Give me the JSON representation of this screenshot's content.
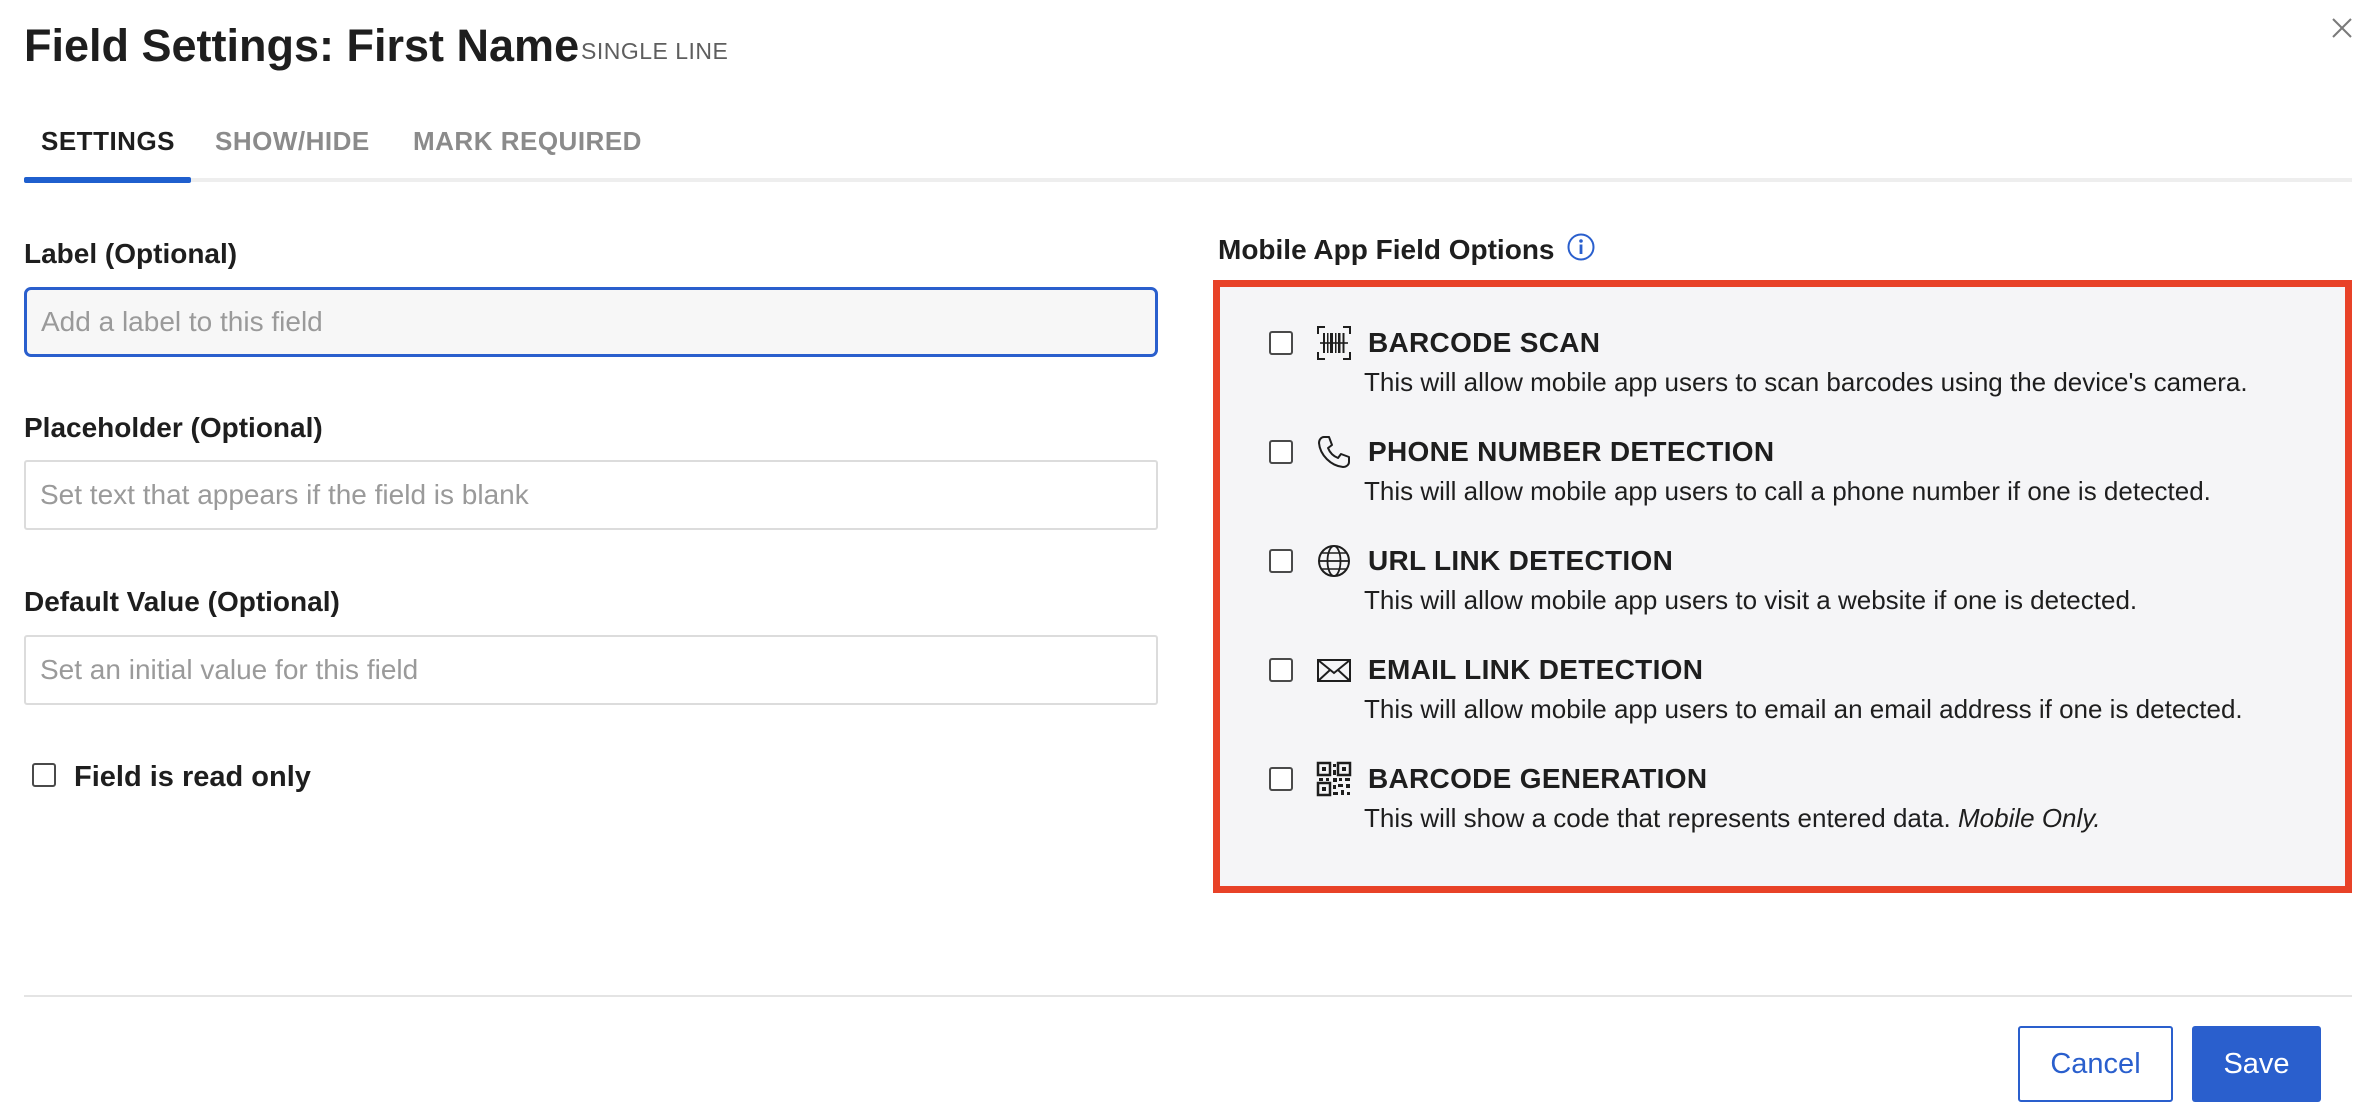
{
  "header": {
    "title": "Field Settings: First Name",
    "subtitle": "SINGLE LINE",
    "close_icon": "close-icon"
  },
  "tabs": [
    {
      "label": "SETTINGS",
      "active": true
    },
    {
      "label": "SHOW/HIDE",
      "active": false
    },
    {
      "label": "MARK REQUIRED",
      "active": false
    }
  ],
  "form": {
    "label_field": {
      "label": "Label (Optional)",
      "placeholder": "Add a label to this field",
      "value": ""
    },
    "placeholder_field": {
      "label": "Placeholder (Optional)",
      "placeholder": "Set text that appears if the field is blank",
      "value": ""
    },
    "default_field": {
      "label": "Default Value (Optional)",
      "placeholder": "Set an initial value for this field",
      "value": ""
    },
    "read_only": {
      "label": "Field is read only",
      "checked": false
    }
  },
  "mobile_options": {
    "title": "Mobile App Field Options",
    "info_icon": "info-icon",
    "items": [
      {
        "title": "BARCODE SCAN",
        "description": "This will allow mobile app users to scan barcodes using the device's camera.",
        "icon": "barcode-icon",
        "checked": false
      },
      {
        "title": "PHONE NUMBER DETECTION",
        "description": "This will allow mobile app users to call a phone number if one is detected.",
        "icon": "phone-icon",
        "checked": false
      },
      {
        "title": "URL LINK DETECTION",
        "description": "This will allow mobile app users to visit a website if one is detected.",
        "icon": "globe-icon",
        "checked": false
      },
      {
        "title": "EMAIL LINK DETECTION",
        "description": "This will allow mobile app users to email an email address if one is detected.",
        "icon": "envelope-icon",
        "checked": false
      },
      {
        "title": "BARCODE GENERATION",
        "description": "This will show a code that represents entered data.",
        "description_emphasis": "Mobile Only.",
        "icon": "qr-code-icon",
        "checked": false
      }
    ]
  },
  "footer": {
    "cancel_label": "Cancel",
    "save_label": "Save"
  },
  "colors": {
    "accent": "#2a5fcd",
    "highlight_border": "#e84228",
    "panel_background": "#f5f5f7"
  }
}
